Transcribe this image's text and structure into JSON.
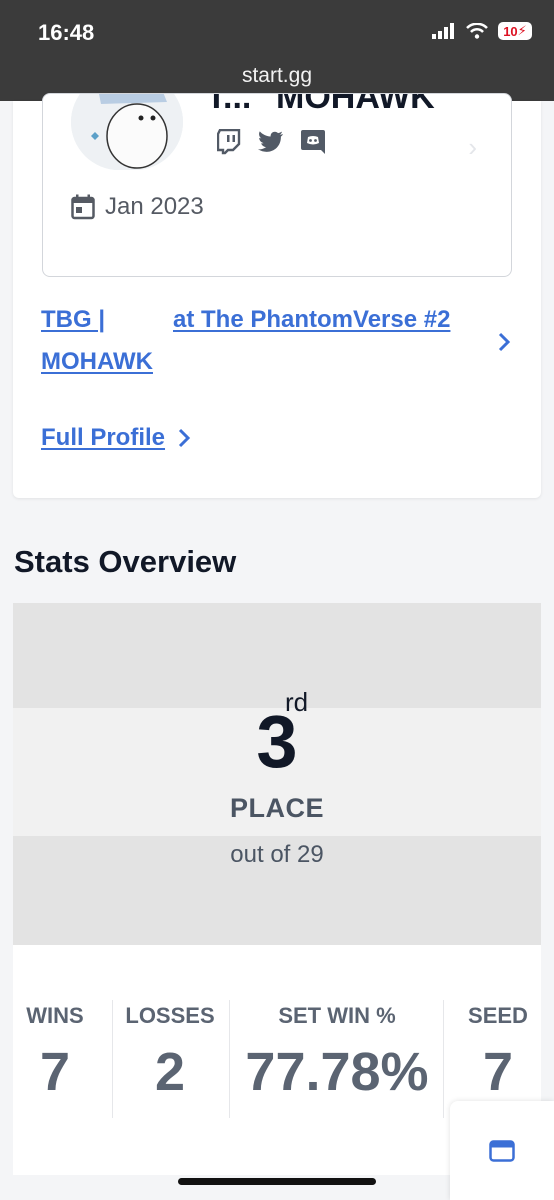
{
  "status_bar": {
    "time": "16:48",
    "battery": "10"
  },
  "browser": {
    "url": "start.gg"
  },
  "profile": {
    "name_prefix": "T...",
    "name": "MOHAWK",
    "socials": [
      "twitch-icon",
      "twitter-icon",
      "discord-icon"
    ],
    "date": "Jan 2023"
  },
  "entrant_link": {
    "line1": "TBG |",
    "line2": "MOHAWK",
    "event": "at The PhantomVerse #2"
  },
  "full_profile_label": "Full Profile",
  "stats_overview": {
    "title": "Stats Overview",
    "placement": {
      "number": "3",
      "suffix": "rd",
      "label": "PLACE",
      "sub": "out of 29"
    },
    "stats": [
      {
        "label": "WINS",
        "value": "7"
      },
      {
        "label": "LOSSES",
        "value": "2"
      },
      {
        "label": "SET WIN %",
        "value": "77.78%"
      },
      {
        "label": "SEED",
        "value": "7"
      }
    ]
  },
  "colors": {
    "link": "#3b6fd6",
    "text": "#111827",
    "muted": "#5b6472"
  }
}
